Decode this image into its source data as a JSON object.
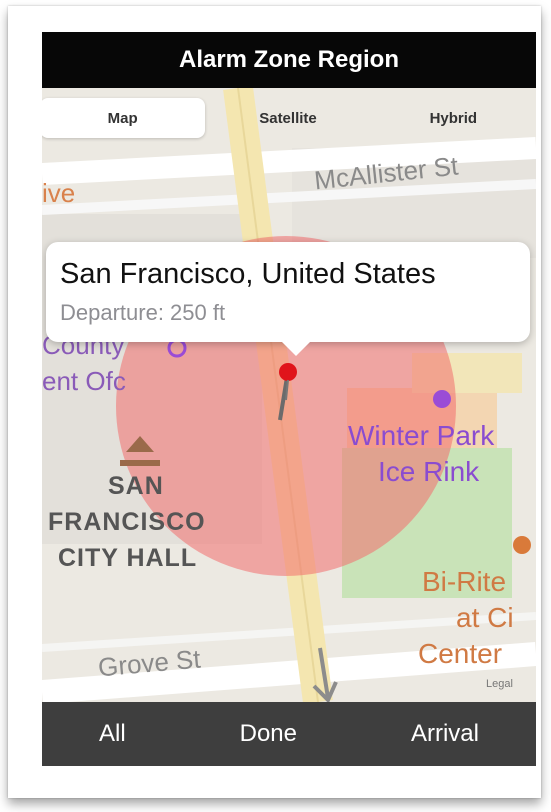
{
  "nav": {
    "title": "Alarm Zone Region"
  },
  "map_type": {
    "options": [
      "Map",
      "Satellite",
      "Hybrid"
    ],
    "selected": "Map"
  },
  "map_labels": {
    "street_1": "McAllister St",
    "street_2": "Grove St",
    "fragment_ive": "ive",
    "fragment_county": "County",
    "fragment_ent_ofc": "ent Ofc",
    "poi_winter_park_1": "Winter Park",
    "poi_winter_park_2": "Ice Rink",
    "city_hall_1": "SAN",
    "city_hall_2": "FRANCISCO",
    "city_hall_3": "CITY HALL",
    "bi_rite_1": "Bi-Rite",
    "bi_rite_2": "at Ci",
    "bi_rite_3": "Center",
    "legal": "Legal"
  },
  "callout": {
    "title": "San Francisco, United States",
    "subtitle": "Departure: 250 ft"
  },
  "toolbar": {
    "all_label": "All",
    "done_label": "Done",
    "arrival_label": "Arrival"
  },
  "colors": {
    "zone_fill": "#f26d6d",
    "pin": "#e0141b",
    "poi_purple": "#9a4cd6",
    "poi_orange": "#d97a3a"
  }
}
